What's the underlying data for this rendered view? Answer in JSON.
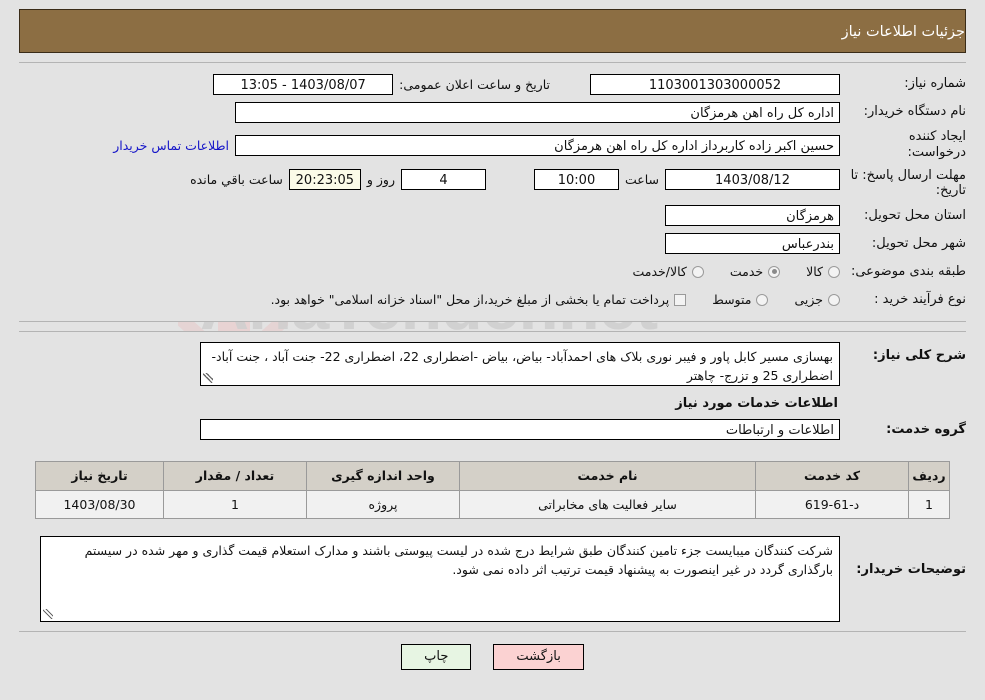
{
  "header": {
    "title": "جزئیات اطلاعات نیاز",
    "bg_color": "#8c6e43",
    "text_color": "#ffffff"
  },
  "watermark": {
    "text": "AriaTender.net"
  },
  "form": {
    "need_number": {
      "label": "شماره نیاز:",
      "value": "1103001303000052"
    },
    "announce_datetime": {
      "label": "تاریخ و ساعت اعلان عمومی:",
      "value": "13:05 - 1403/08/07"
    },
    "buyer_org": {
      "label": "نام دستگاه خریدار:",
      "value": "اداره کل راه اهن هرمزگان"
    },
    "requester": {
      "label": "ایجاد کننده درخواست:",
      "value": "حسین اکبر زاده  کاربرداز اداره کل راه اهن هرمزگان"
    },
    "contact_link": {
      "label": "اطلاعات تماس خریدار"
    },
    "deadline": {
      "label": "مهلت ارسال پاسخ: تا تاریخ:",
      "date": "1403/08/12",
      "hour_label": "ساعت",
      "time": "10:00",
      "days": "4",
      "days_label": "روز و",
      "countdown": "20:23:05",
      "countdown_label": "ساعت باقي مانده"
    },
    "province": {
      "label": "استان محل تحویل:",
      "value": "هرمزگان"
    },
    "city": {
      "label": "شهر محل تحویل:",
      "value": "بندرعباس"
    },
    "classification": {
      "label": "طبقه بندی موضوعی:",
      "options": [
        {
          "label": "کالا",
          "selected": false
        },
        {
          "label": "خدمت",
          "selected": true
        },
        {
          "label": "کالا/خدمت",
          "selected": false
        }
      ]
    },
    "purchase_process": {
      "label": "نوع فرآیند خرید :",
      "options": [
        {
          "label": "جزیی",
          "selected": false
        },
        {
          "label": "متوسط",
          "selected": false
        }
      ],
      "checkbox_note": "پرداخت تمام یا بخشی از مبلغ خرید،از محل \"اسناد خزانه اسلامی\" خواهد بود.",
      "checkbox_checked": false
    }
  },
  "need_description": {
    "label": "شرح کلی نیاز:",
    "value": "بهسازی مسیر کابل پاور و فیبر نوری بلاک های احمدآباد- بیاض، بیاض -اضطراری 22، اضطراری 22- جنت آباد ، جنت آباد- اضطراری 25 و تزرج- چاهتر"
  },
  "services_section": {
    "title": "اطلاعات خدمات مورد نیاز",
    "service_group": {
      "label": "گروه خدمت:",
      "value": "اطلاعات و ارتباطات"
    }
  },
  "table": {
    "columns": [
      "ردیف",
      "کد خدمت",
      "نام خدمت",
      "واحد اندازه گیری",
      "تعداد / مقدار",
      "تاریخ نیاز"
    ],
    "rows": [
      {
        "row": "1",
        "service_code": "د-61-619",
        "service_name": "سایر فعالیت های مخابراتی",
        "unit": "پروژه",
        "quantity": "1",
        "need_date": "1403/08/30"
      }
    ]
  },
  "buyer_notes": {
    "label": "توضیحات خریدار:",
    "value": "شرکت کنندگان میبایست جزء تامین کنندگان طبق شرایط درج شده در لیست پیوستی باشند و مدارک استعلام قیمت گذاری و مهر شده در سیستم بارگذاری گردد در غیر اینصورت به پیشنهاد قیمت ترتیب اثر داده نمی شود."
  },
  "footer": {
    "print_label": "چاپ",
    "back_label": "بازگشت",
    "print_color": "#e7f5e3",
    "back_color": "#fbd2d2"
  }
}
